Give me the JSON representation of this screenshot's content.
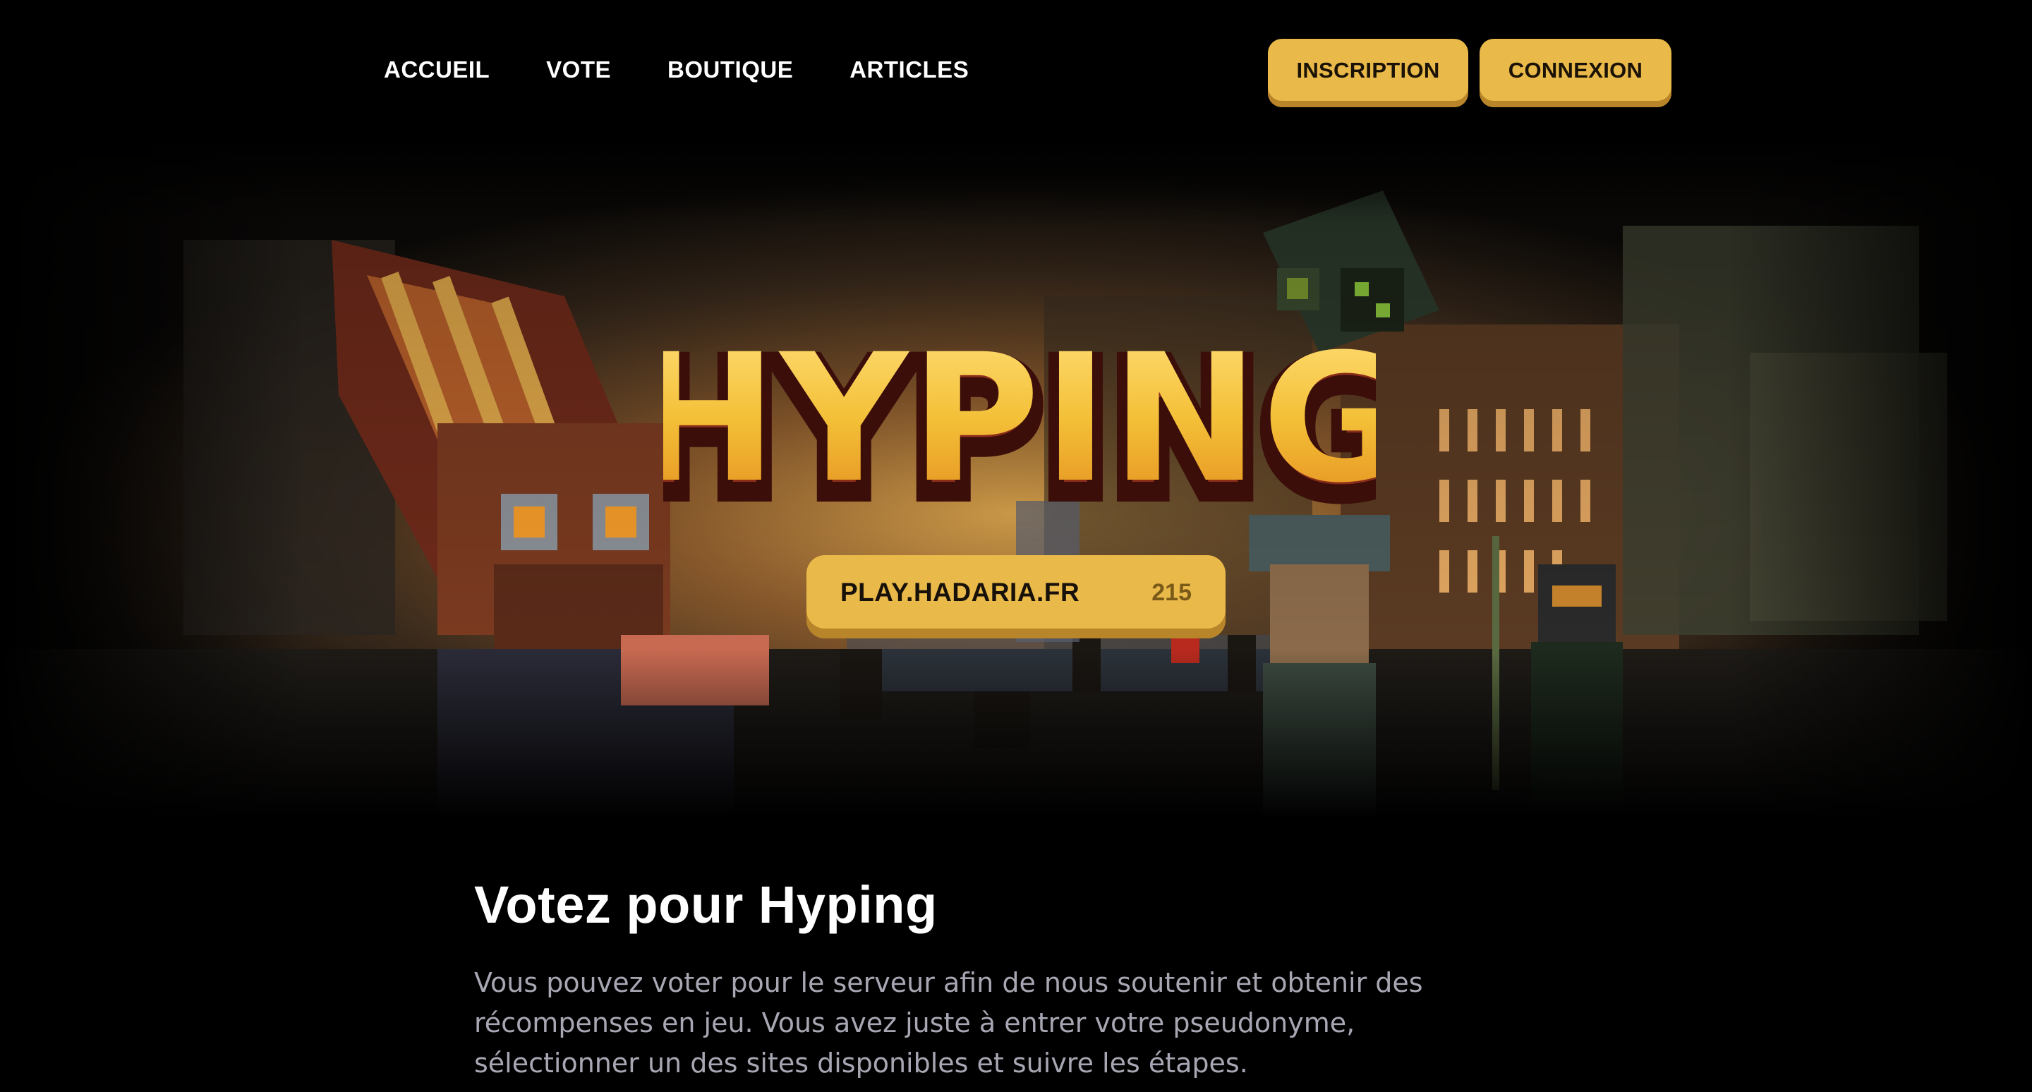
{
  "nav": {
    "links": [
      "ACCUEIL",
      "VOTE",
      "BOUTIQUE",
      "ARTICLES"
    ],
    "inscription_label": "INSCRIPTION",
    "connexion_label": "CONNEXION"
  },
  "hero": {
    "logo_text": "HYPING",
    "server_ip": "PLAY.HADARIA.FR",
    "player_count": "215"
  },
  "vote": {
    "title": "Votez pour Hyping",
    "description": "Vous pouvez voter pour le serveur afin de nous soutenir et obtenir des récompenses en jeu. Vous avez juste à entrer votre pseudonyme, sélectionner un des sites disponibles et suivre les étapes."
  },
  "colors": {
    "accent": "#e9b949",
    "accent_shadow": "#b9852a",
    "background": "#000000",
    "text_muted": "#a7a7b3"
  }
}
